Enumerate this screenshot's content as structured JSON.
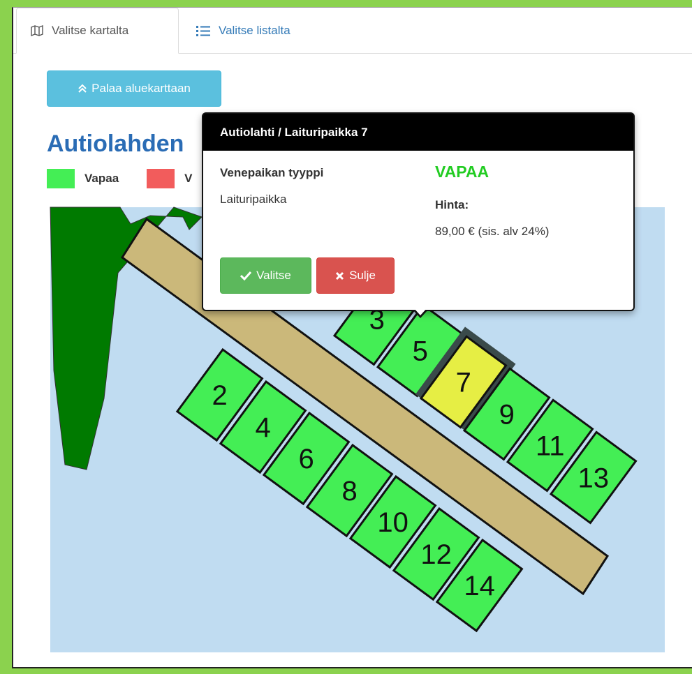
{
  "tabs": [
    {
      "label": "Valitse kartalta",
      "icon": "map-icon",
      "active": true
    },
    {
      "label": "Valitse listalta",
      "icon": "list-icon",
      "active": false
    }
  ],
  "back_button": {
    "label": "Palaa aluekarttaan",
    "icon": "double-chevron-up-icon"
  },
  "page_title": "Autiolahden",
  "legend": [
    {
      "label": "Vapaa",
      "color": "#44ee55"
    },
    {
      "label": "V",
      "color": "#f25c5c"
    }
  ],
  "colors": {
    "water": "#c0dcf1",
    "land": "#007a00",
    "dock": "#cbb87a",
    "free_spot": "#44ee55",
    "selected_spot": "#e6ee44",
    "popover_header": "#000000",
    "status_free": "#22cc22"
  },
  "map": {
    "spots": [
      "3",
      "5",
      "7",
      "9",
      "11",
      "13",
      "2",
      "4",
      "6",
      "8",
      "10",
      "12",
      "14"
    ],
    "selected_spot": "7"
  },
  "popover": {
    "title": "Autiolahti / Laituripaikka 7",
    "type_label": "Venepaikan tyyppi",
    "type_value": "Laituripaikka",
    "status": "VAPAA",
    "price_label": "Hinta:",
    "price_value": "89,00 € (sis. alv 24%)",
    "select_label": "Valitse",
    "close_label": "Sulje"
  }
}
